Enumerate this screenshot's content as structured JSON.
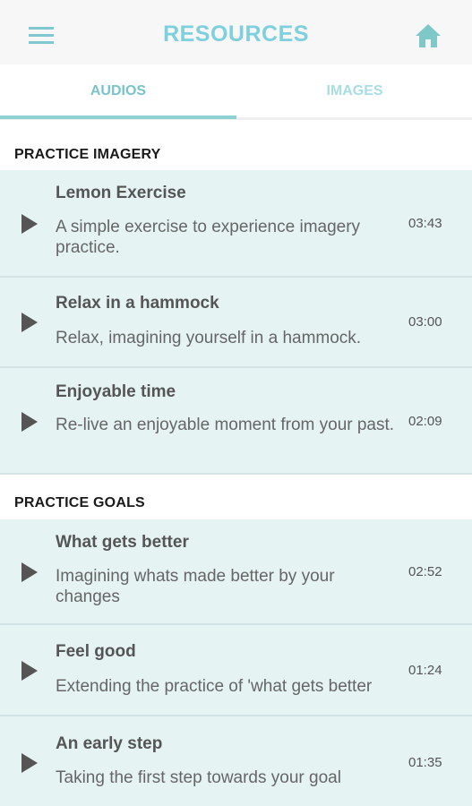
{
  "header": {
    "title": "RESOURCES",
    "menu_icon": "hamburger-menu-icon",
    "home_icon": "home-icon",
    "accent_color": "#7fd0de"
  },
  "tabs": [
    {
      "label": "AUDIOS",
      "active": true
    },
    {
      "label": "IMAGES",
      "active": false
    }
  ],
  "sections": [
    {
      "title": "PRACTICE IMAGERY",
      "items": [
        {
          "title": "Lemon Exercise",
          "description": "A simple exercise to experience imagery practice.",
          "duration": "03:43"
        },
        {
          "title": "Relax in a hammock",
          "description": "Relax, imagining yourself in a hammock.",
          "duration": "03:00"
        },
        {
          "title": "Enjoyable time",
          "description": "Re-live an enjoyable moment from your past.",
          "duration": "02:09"
        }
      ]
    },
    {
      "title": "PRACTICE GOALS",
      "items": [
        {
          "title": "What gets better",
          "description": "Imagining whats made better by your changes",
          "duration": "02:52"
        },
        {
          "title": "Feel good",
          "description": "Extending the practice of 'what gets better",
          "duration": "01:24"
        },
        {
          "title": "An early step",
          "description": "Taking the first step towards your goal",
          "duration": "01:35"
        }
      ]
    }
  ],
  "colors": {
    "row_background": "#e5f3f3",
    "tab_active": "#78c4c8",
    "tab_inactive": "#a8dde6"
  }
}
